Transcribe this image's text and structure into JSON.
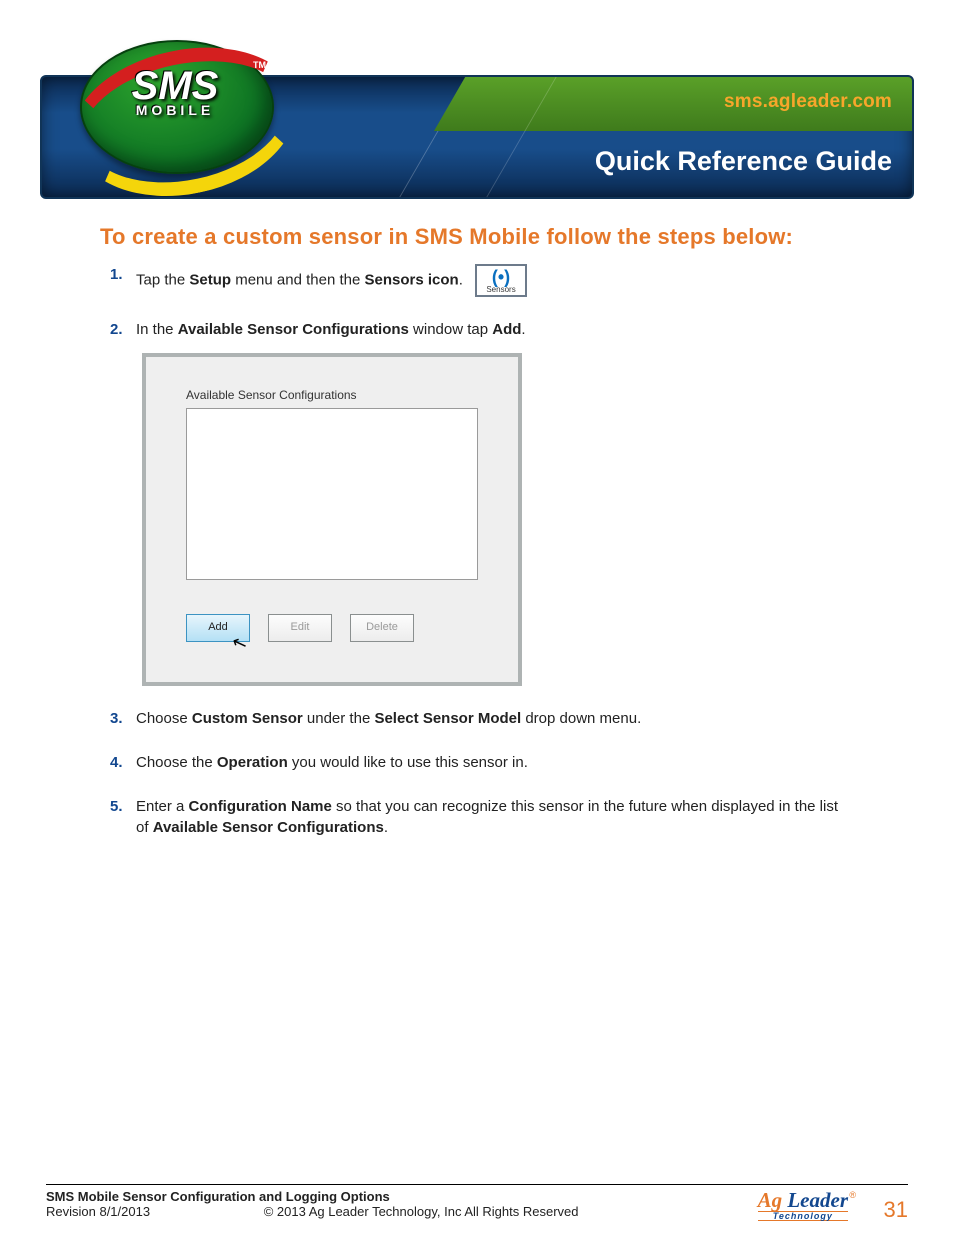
{
  "header": {
    "url": "sms.agleader.com",
    "title": "Quick Reference Guide",
    "logo_main": "SMS",
    "logo_sub": "MOBILE",
    "logo_tm": "TM"
  },
  "section_title": "To create a custom sensor in SMS Mobile follow the steps below:",
  "steps": {
    "s1": {
      "t1": "Tap the ",
      "b1": "Setup",
      "t2": " menu and then the ",
      "b2": "Sensors icon",
      "t3": ".",
      "icon_label": "Sensors"
    },
    "s2": {
      "t1": "In the ",
      "b1": "Available Sensor Configurations",
      "t2": " window tap ",
      "b2": "Add",
      "t3": "."
    },
    "s3": {
      "t1": "Choose ",
      "b1": "Custom Sensor",
      "t2": " under the ",
      "b2": "Select Sensor Model",
      "t3": " drop down menu."
    },
    "s4": {
      "t1": "Choose the ",
      "b1": "Operation",
      "t2": " you would like to use this sensor in."
    },
    "s5": {
      "t1": "Enter a ",
      "b1": "Configuration Name",
      "t2": " so that you can recognize this sensor in the future when displayed in the list of ",
      "b2": "Available Sensor Configurations",
      "t3": "."
    }
  },
  "screenshot": {
    "title": "Available Sensor Configurations",
    "add": "Add",
    "edit": "Edit",
    "delete": "Delete"
  },
  "footer": {
    "doc_title": "SMS Mobile Sensor Configuration and Logging Options",
    "revision": "Revision 8/1/2013",
    "copyright": "© 2013 Ag Leader Technology, Inc All Rights Reserved",
    "page": "31",
    "logo_ag": "Ag",
    "logo_leader": " Leader",
    "logo_tech": "Technology",
    "logo_reg": "®"
  }
}
